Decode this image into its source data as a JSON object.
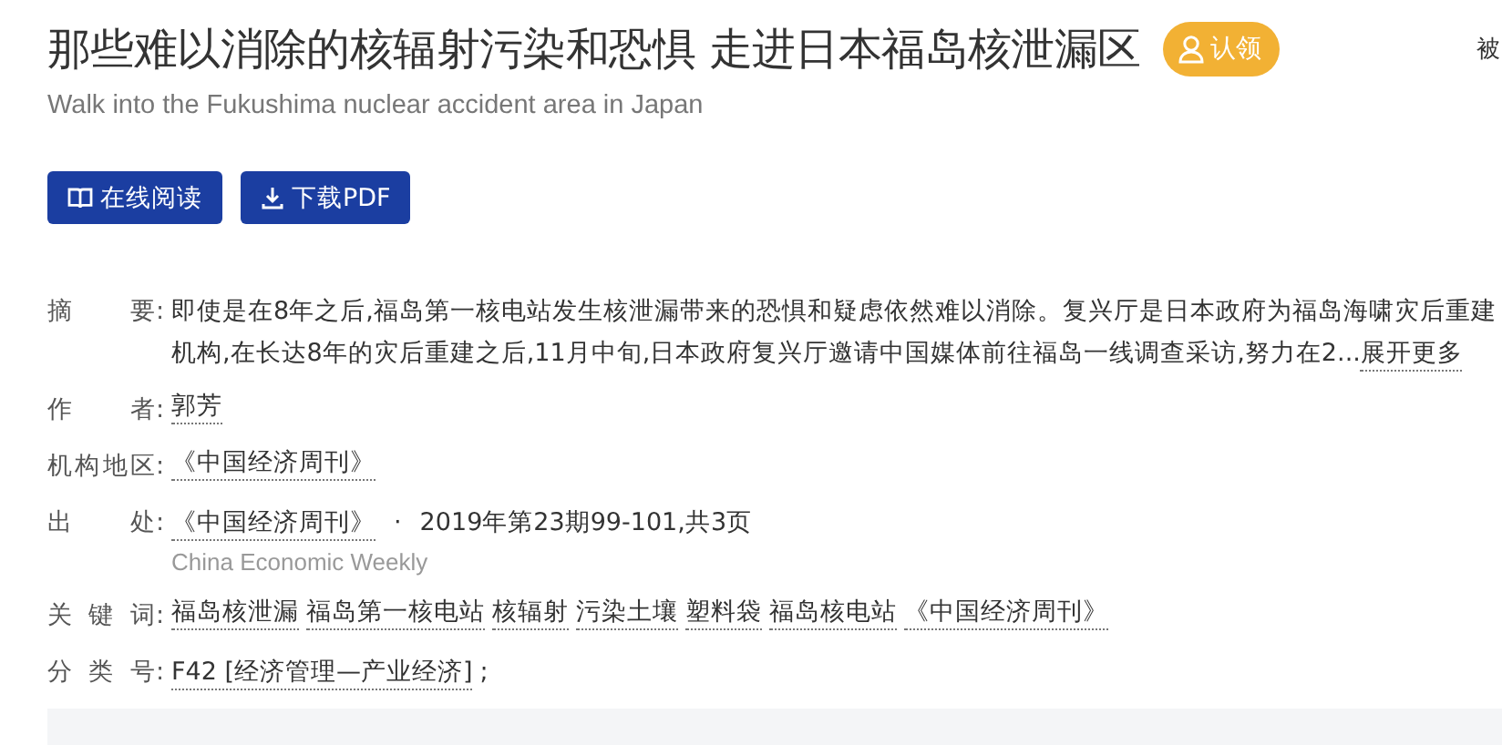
{
  "title": "那些难以消除的核辐射污染和恐惧 走进日本福岛核泄漏区",
  "claim_badge": "认领",
  "cited_label": "被",
  "subtitle": "Walk into the Fukushima nuclear accident area in Japan",
  "buttons": [
    {
      "kind": "read",
      "label": "在线阅读"
    },
    {
      "kind": "download",
      "label": "下载PDF"
    }
  ],
  "abstract": {
    "label": "摘 要:",
    "lines": [
      "即使是在8年之后,福岛第一核电站发生核泄漏带来的恐惧和疑虑依然难以消除。复兴厅是日本政府为福岛海啸灾后重建",
      "机构,在长达8年的灾后重建之后,11月中旬,日本政府复兴厅邀请中国媒体前往福岛一线调查采访,努力在2..."
    ],
    "expand": "展开更多"
  },
  "author": {
    "label": "作 者:",
    "value": "郭芳"
  },
  "organization": {
    "label": "机构地区:",
    "value": "《中国经济周刊》"
  },
  "source": {
    "label": "出 处:",
    "journal": "《中国经济周刊》",
    "separator": "·",
    "issue": "2019年第23期99-101,共3页",
    "journal_en": "China Economic Weekly"
  },
  "keywords": {
    "label": "关 键 词:",
    "items": [
      "福岛核泄漏",
      "福岛第一核电站",
      "核辐射",
      "污染土壤",
      "塑料袋",
      "福岛核电站",
      "《中国经济周刊》"
    ]
  },
  "classification": {
    "label": "分 类 号:",
    "value": "F42 [经济管理—产业经济]",
    "suffix": ";"
  }
}
